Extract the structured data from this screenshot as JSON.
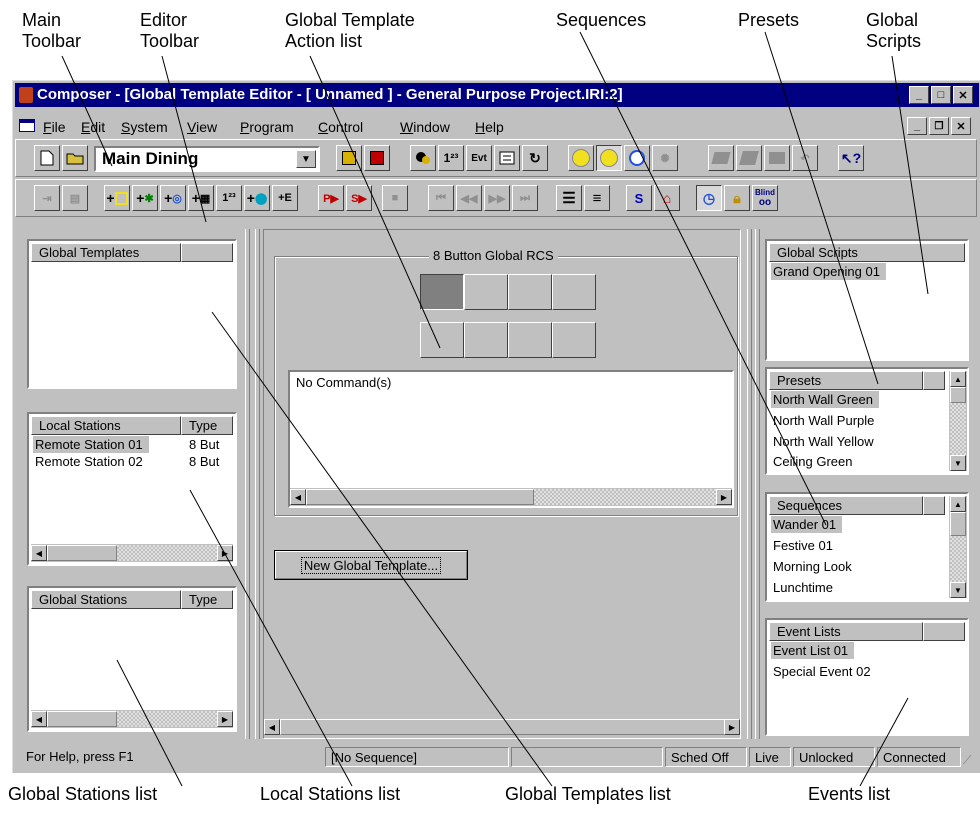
{
  "callouts": {
    "main_toolbar": "Main\nToolbar",
    "editor_toolbar": "Editor\nToolbar",
    "global_template_action_list": "Global Template\nAction list",
    "sequences": "Sequences",
    "presets": "Presets",
    "global_scripts": "Global\nScripts",
    "global_stations_list": "Global Stations list",
    "local_stations_list": "Local Stations list",
    "global_templates_list": "Global Templates list",
    "events_list": "Events list"
  },
  "window": {
    "title": "Composer - [Global Template Editor - [ Unnamed ] - General Purpose Project.IRI:2]"
  },
  "menu": {
    "items": [
      "File",
      "Edit",
      "System",
      "View",
      "Program",
      "Control",
      "Window",
      "Help"
    ],
    "underline": [
      "F",
      "E",
      "S",
      "V",
      "P",
      "C",
      "W",
      "H"
    ],
    "rest": [
      "ile",
      "dit",
      "ystem",
      "iew",
      "rogram",
      "ontrol",
      "indow",
      "elp"
    ]
  },
  "toolbar": {
    "location_combo": "Main Dining",
    "evt_label": "Evt",
    "counter_label": "1²³",
    "counter_label2": "1²³",
    "blind_label": "Blind",
    "s_label": "S"
  },
  "panels": {
    "global_templates": {
      "header": "Global Templates"
    },
    "local_stations": {
      "headers": [
        "Local Stations",
        "Type"
      ],
      "rows": [
        {
          "name": "Remote Station 01",
          "type": "8 But"
        },
        {
          "name": "Remote Station 02",
          "type": "8 But"
        }
      ]
    },
    "global_stations": {
      "headers": [
        "Global Stations",
        "Type"
      ]
    },
    "rcs": {
      "group_label": "8 Button Global RCS",
      "commands": "No Command(s)",
      "new_button": "New Global Template..."
    },
    "global_scripts": {
      "header": "Global Scripts",
      "items": [
        "Grand Opening 01"
      ]
    },
    "presets": {
      "header": "Presets",
      "items": [
        "North Wall Green",
        "North Wall Purple",
        "North Wall Yellow",
        "Ceiling Green"
      ]
    },
    "sequences": {
      "header": "Sequences",
      "items": [
        "Wander 01",
        "Festive 01",
        "Morning Look",
        "Lunchtime"
      ]
    },
    "event_lists": {
      "header": "Event Lists",
      "items": [
        "Event List 01",
        "Special Event 02"
      ]
    }
  },
  "statusbar": {
    "help": "For Help, press F1",
    "sequence": "[No Sequence]",
    "sched": "Sched Off",
    "live": "Live",
    "lock": "Unlocked",
    "conn": "Connected"
  },
  "colors": {
    "title_bar": "#000080",
    "face": "#c0c0c0",
    "pressed_rcs_button": "#808080"
  }
}
